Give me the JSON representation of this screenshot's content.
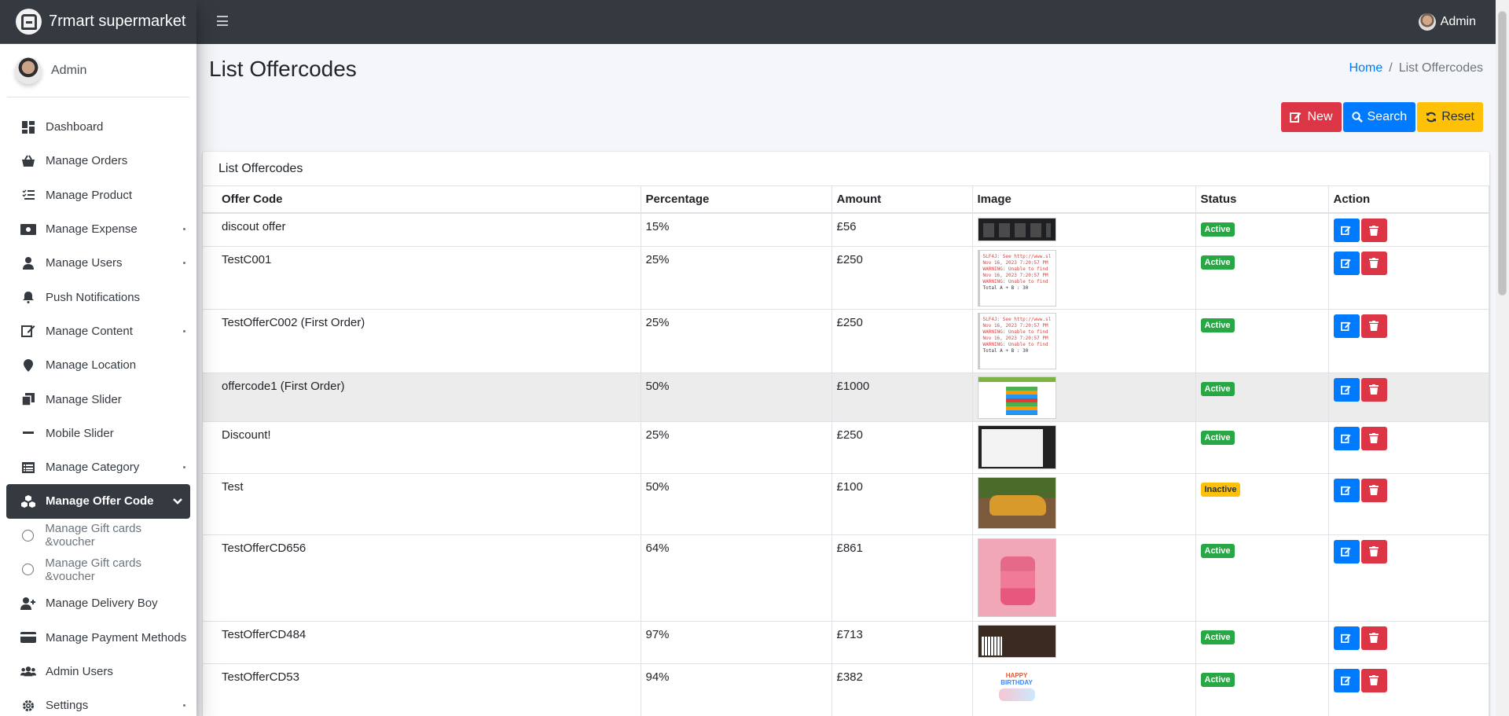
{
  "brand": {
    "name": "7rmart supermarket"
  },
  "user": {
    "name": "Admin"
  },
  "topbar": {
    "user": "Admin"
  },
  "sidebar": {
    "items": [
      {
        "label": "Dashboard",
        "icon": "dashboard-icon"
      },
      {
        "label": "Manage Orders",
        "icon": "basket-icon"
      },
      {
        "label": "Manage Product",
        "icon": "list-check-icon"
      },
      {
        "label": "Manage Expense",
        "icon": "money-icon"
      },
      {
        "label": "Manage Users",
        "icon": "user-icon"
      },
      {
        "label": "Push Notifications",
        "icon": "bell-icon"
      },
      {
        "label": "Manage Content",
        "icon": "edit-icon"
      },
      {
        "label": "Manage Location",
        "icon": "map-marker-icon"
      },
      {
        "label": "Manage Slider",
        "icon": "clone-icon"
      },
      {
        "label": "Mobile Slider",
        "icon": "minus-icon"
      },
      {
        "label": "Manage Category",
        "icon": "list-alt-icon"
      },
      {
        "label": "Manage Offer Code",
        "icon": "cubes-icon"
      },
      {
        "label": "Manage Gift cards &voucher",
        "icon": "circle-icon"
      },
      {
        "label": "Manage Gift cards &voucher",
        "icon": "circle-icon"
      },
      {
        "label": "Manage Delivery Boy",
        "icon": "user-plus-icon"
      },
      {
        "label": "Manage Payment Methods",
        "icon": "credit-card-icon"
      },
      {
        "label": "Admin Users",
        "icon": "users-icon"
      },
      {
        "label": "Settings",
        "icon": "cog-icon"
      }
    ]
  },
  "page": {
    "title": "List Offercodes"
  },
  "breadcrumb": {
    "home": "Home",
    "separator": "/",
    "current": "List Offercodes"
  },
  "buttons": {
    "new": "New",
    "search": "Search",
    "reset": "Reset"
  },
  "card": {
    "title": "List Offercodes"
  },
  "table": {
    "headers": [
      "Offer Code",
      "Percentage",
      "Amount",
      "Image",
      "Status",
      "Action"
    ],
    "rows": [
      {
        "code": "discout offer",
        "percentage": "15%",
        "amount": "£56",
        "image": "dark-spreadsheet",
        "status": "Active"
      },
      {
        "code": "TestC001",
        "percentage": "25%",
        "amount": "£250",
        "image": "console-log",
        "status": "Active"
      },
      {
        "code": "TestOfferC002 (First Order)",
        "percentage": "25%",
        "amount": "£250",
        "image": "console-log",
        "status": "Active"
      },
      {
        "code": "offercode1 (First Order)",
        "percentage": "50%",
        "amount": "£1000",
        "image": "green-dashboard",
        "status": "Active"
      },
      {
        "code": "Discount!",
        "percentage": "25%",
        "amount": "£250",
        "image": "screen-capture",
        "status": "Active"
      },
      {
        "code": "Test",
        "percentage": "50%",
        "amount": "£100",
        "image": "orange-car",
        "status": "Inactive"
      },
      {
        "code": "TestOfferCD656",
        "percentage": "64%",
        "amount": "£861",
        "image": "pink-cake",
        "status": "Active"
      },
      {
        "code": "TestOfferCD484",
        "percentage": "97%",
        "amount": "£713",
        "image": "piano-room",
        "status": "Active"
      },
      {
        "code": "TestOfferCD53",
        "percentage": "94%",
        "amount": "£382",
        "image": "birthday-cake",
        "status": "Active"
      }
    ]
  },
  "log_text": [
    "SLF4J: See http://www.sl",
    "Nov 16, 2023 7:20:57 PM",
    "WARNING: Unable to find",
    "Nov 16, 2023 7:20:57 PM",
    "WARNING: Unable to find",
    "Total A + B : 30"
  ],
  "bday_text": [
    "HAPPY",
    "BIRTHDAY"
  ],
  "colors": {
    "sidebar_active": "#343a40",
    "primary": "#007bff",
    "danger": "#dc3545",
    "warning": "#ffc107",
    "success": "#28a745"
  }
}
